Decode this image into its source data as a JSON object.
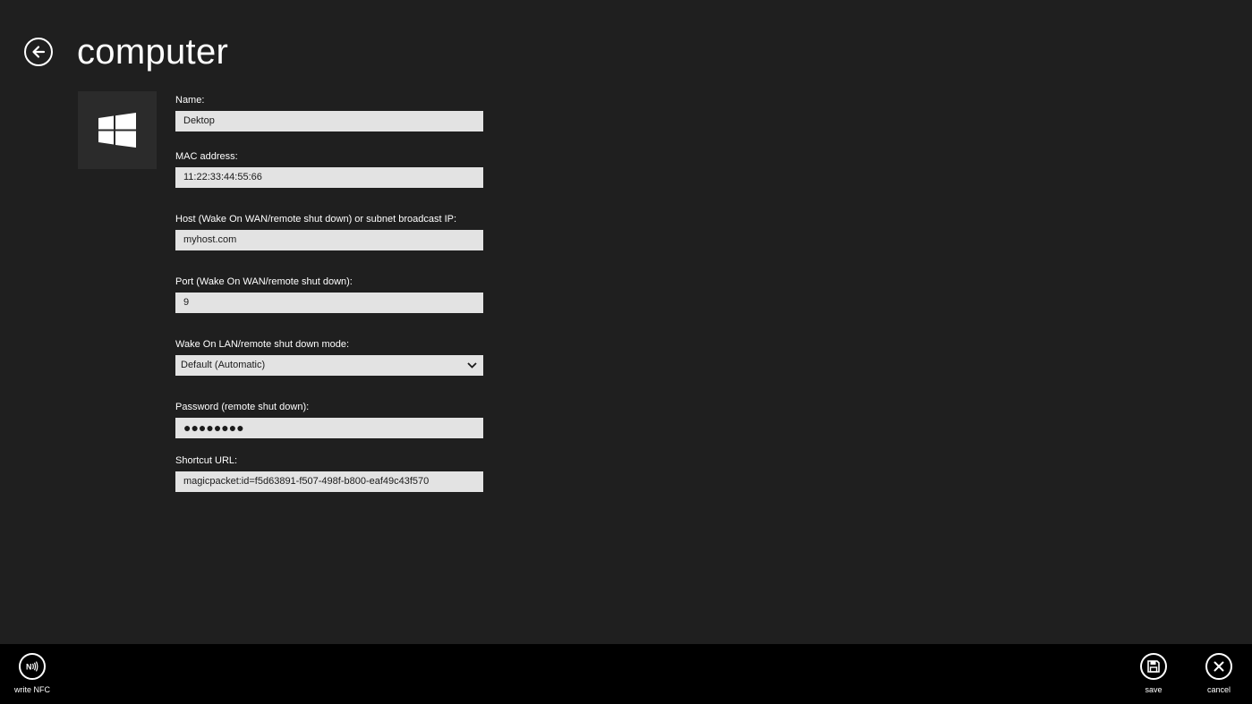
{
  "header": {
    "title": "computer",
    "back_icon": "back-arrow-icon"
  },
  "tile": {
    "icon": "windows-logo-icon"
  },
  "form": {
    "name": {
      "label": "Name:",
      "value": "Dektop"
    },
    "mac": {
      "label": "MAC address:",
      "value": "11:22:33:44:55:66"
    },
    "host": {
      "label": "Host (Wake On WAN/remote shut down) or subnet broadcast IP:",
      "value": "myhost.com"
    },
    "port": {
      "label": "Port (Wake On WAN/remote shut down):",
      "value": "9"
    },
    "mode": {
      "label": "Wake On LAN/remote shut down mode:",
      "selected": "Default (Automatic)"
    },
    "password": {
      "label": "Password (remote shut down):",
      "value": "●●●●●●●●"
    },
    "shortcut": {
      "label": "Shortcut URL:",
      "value": "magicpacket:id=f5d63891-f507-498f-b800-eaf49c43f570"
    }
  },
  "app_bar": {
    "write_nfc": {
      "label": "write NFC",
      "icon": "nfc-icon"
    },
    "save": {
      "label": "save",
      "icon": "save-icon"
    },
    "cancel": {
      "label": "cancel",
      "icon": "close-icon"
    }
  },
  "colors": {
    "background": "#1f1f1f",
    "app_bar": "#000000",
    "input_bg": "#e3e3e3",
    "tile_bg": "#2b2b2b"
  }
}
